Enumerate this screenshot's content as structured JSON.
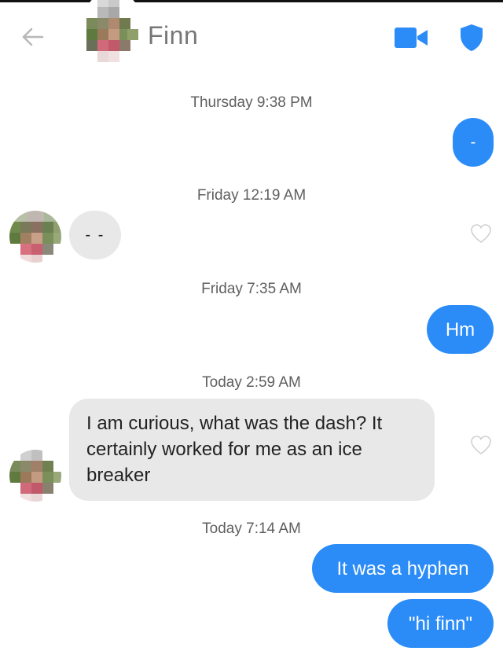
{
  "header": {
    "contact_name": "Finn",
    "back_icon": "arrow-left-icon",
    "video_icon": "video-camera-icon",
    "safety_icon": "shield-icon",
    "accent_color": "#2b8cf7"
  },
  "conversation": [
    {
      "type": "timestamp",
      "day": "Thursday",
      "time": "9:38 PM"
    },
    {
      "type": "message",
      "direction": "sent",
      "text": "-"
    },
    {
      "type": "timestamp",
      "day": "Friday",
      "time": "12:19 AM"
    },
    {
      "type": "message",
      "direction": "received",
      "text": "- -"
    },
    {
      "type": "timestamp",
      "day": "Friday",
      "time": "7:35 AM"
    },
    {
      "type": "message",
      "direction": "sent",
      "text": "Hm"
    },
    {
      "type": "timestamp",
      "day": "Today",
      "time": "2:59 AM"
    },
    {
      "type": "message",
      "direction": "received",
      "text": "I am curious, what was the dash? It certainly worked for me as an ice breaker"
    },
    {
      "type": "timestamp",
      "day": "Today",
      "time": "7:14 AM"
    },
    {
      "type": "message",
      "direction": "sent",
      "text": "It was a hyphen"
    },
    {
      "type": "message",
      "direction": "sent",
      "text": "\"hi finn\""
    }
  ],
  "colors": {
    "sent_bubble": "#2b8cf7",
    "received_bubble": "#e8e8e8",
    "timestamp_text": "#5f5f5f"
  }
}
